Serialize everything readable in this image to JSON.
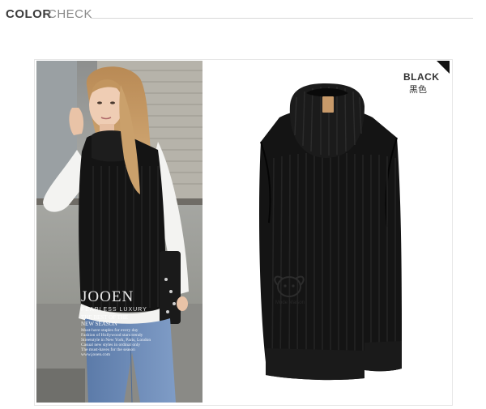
{
  "header": {
    "title_strong": "COLOR",
    "title_light": "CHECK"
  },
  "swatch": {
    "name": "BLACK",
    "name_cn": "黑色",
    "garment_color": "#141414"
  },
  "magazine": {
    "brand": "JOOEN",
    "kicker": "FEARLESS LUXURY",
    "headline": [
      "THE BEST OF THE",
      "NEW SEASON"
    ],
    "body_lines": [
      "Must-have staples for every day",
      "Fashion of Hollywood stars trendy",
      "Streetstyle in New York, Paris, London",
      "Casual new styles in ordinal only",
      "The must-haves for the season",
      "www.jooen.com"
    ]
  },
  "logo": {
    "text": "Mode Maison"
  }
}
